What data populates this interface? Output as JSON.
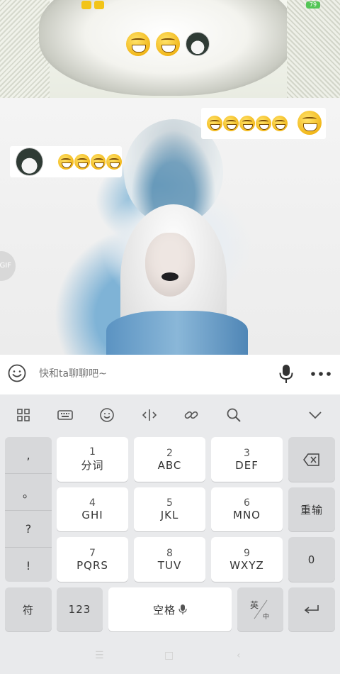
{
  "status_bar": {
    "battery": "79"
  },
  "input": {
    "placeholder": "快和ta聊聊吧~"
  },
  "gif_label": "GIF",
  "keyboard": {
    "punctuation": [
      ",",
      "。",
      "?",
      "!"
    ],
    "keys": [
      {
        "num": "1",
        "letters": "分词"
      },
      {
        "num": "2",
        "letters": "ABC"
      },
      {
        "num": "3",
        "letters": "DEF"
      },
      {
        "num": "4",
        "letters": "GHI"
      },
      {
        "num": "5",
        "letters": "JKL"
      },
      {
        "num": "6",
        "letters": "MNO"
      },
      {
        "num": "7",
        "letters": "PQRS"
      },
      {
        "num": "8",
        "letters": "TUV"
      },
      {
        "num": "9",
        "letters": "WXYZ"
      }
    ],
    "reenter": "重输",
    "zero": "0",
    "symbol": "符",
    "num123": "123",
    "space": "空格",
    "lang_top": "英",
    "lang_bottom": "中"
  }
}
